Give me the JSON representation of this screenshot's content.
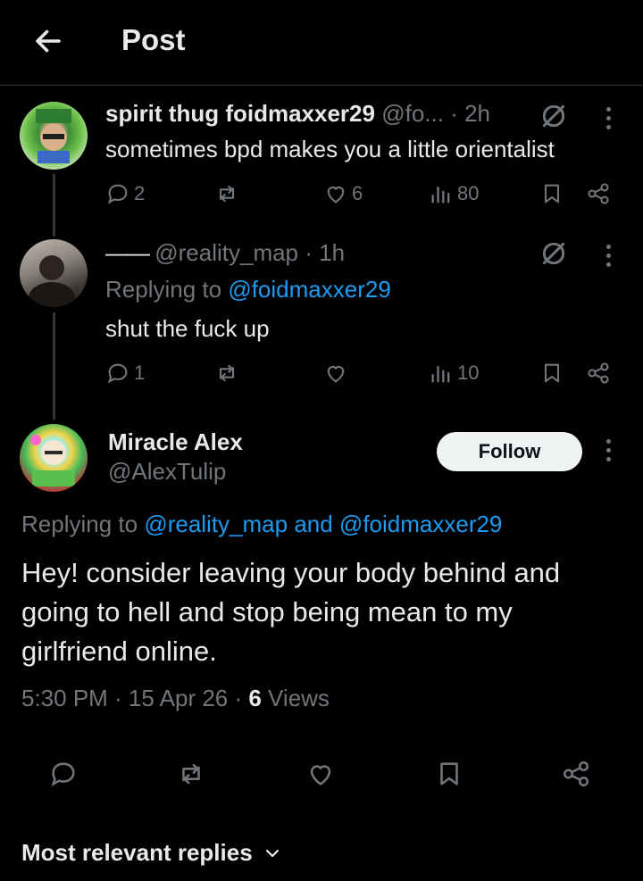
{
  "header": {
    "title": "Post"
  },
  "tweets": [
    {
      "name": "spirit thug foidmaxxer29",
      "handle": "@fo...",
      "time": "· 2h",
      "text": "sometimes bpd makes you a little orientalist",
      "replies": "2",
      "likes": "6",
      "views": "80"
    },
    {
      "name": "——",
      "handle": "@reality_map · 1h",
      "replying_prefix": "Replying to",
      "replying_to": "@foidmaxxer29",
      "text": "shut the fuck up",
      "replies": "1",
      "likes": "",
      "views": "10"
    }
  ],
  "main_tweet": {
    "name": "Miracle Alex",
    "handle": "@AlexTulip",
    "follow_label": "Follow",
    "replying_prefix": "Replying to",
    "replying_to": "@reality_map and @foidmaxxer29",
    "text": "Hey! consider leaving your body behind and going to hell and stop being mean to my girlfriend online.",
    "time": "5:30 PM · 15 Apr 26 · ",
    "views_count": "6",
    "views_label": " Views"
  },
  "replies_sort": {
    "label": "Most relevant replies"
  },
  "colors": {
    "background": "#000000",
    "text": "#e7e9ea",
    "muted": "#71767b",
    "link": "#1d9bf0",
    "divider": "#2f3336"
  }
}
